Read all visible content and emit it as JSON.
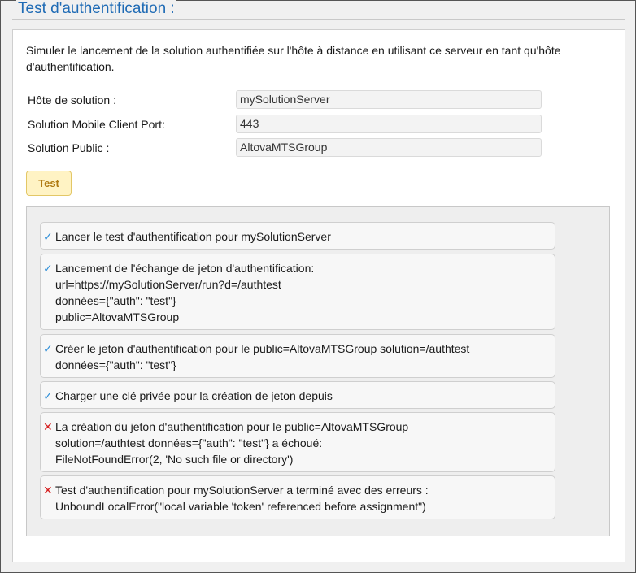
{
  "section": {
    "title": "Test d'authentification :"
  },
  "description": "Simuler le lancement de la solution authentifiée sur l'hôte à distance en utilisant ce serveur en tant qu'hôte d'authentification.",
  "fields": [
    {
      "label": "Hôte de solution :",
      "value": "mySolutionServer"
    },
    {
      "label": "Solution Mobile Client Port:",
      "value": "443"
    },
    {
      "label": "Solution Public :",
      "value": "AltovaMTSGroup"
    }
  ],
  "test_button": {
    "label": "Test"
  },
  "log": [
    {
      "status": "success",
      "icon": "✓",
      "lines": [
        "Lancer le test d'authentification pour mySolutionServer"
      ]
    },
    {
      "status": "success",
      "icon": "✓",
      "lines": [
        "Lancement de l'échange de jeton d'authentification:",
        "url=https://mySolutionServer/run?d=/authtest",
        "données={\"auth\": \"test\"}",
        "public=AltovaMTSGroup"
      ]
    },
    {
      "status": "success",
      "icon": "✓",
      "lines": [
        "Créer le jeton d'authentification pour le public=AltovaMTSGroup solution=/authtest",
        "données={\"auth\": \"test\"}"
      ]
    },
    {
      "status": "success",
      "icon": "✓",
      "lines": [
        "Charger une clé privée pour la création de jeton depuis"
      ]
    },
    {
      "status": "error",
      "icon": "✕",
      "lines": [
        "La création du jeton d'authentification pour le public=AltovaMTSGroup",
        "solution=/authtest données={\"auth\": \"test\"} a échoué:",
        "FileNotFoundError(2, 'No such file or directory')"
      ]
    },
    {
      "status": "error",
      "icon": "✕",
      "lines": [
        "Test d'authentification pour mySolutionServer a terminé avec des erreurs :",
        "UnboundLocalError(\"local variable 'token' referenced before assignment\")"
      ]
    }
  ]
}
